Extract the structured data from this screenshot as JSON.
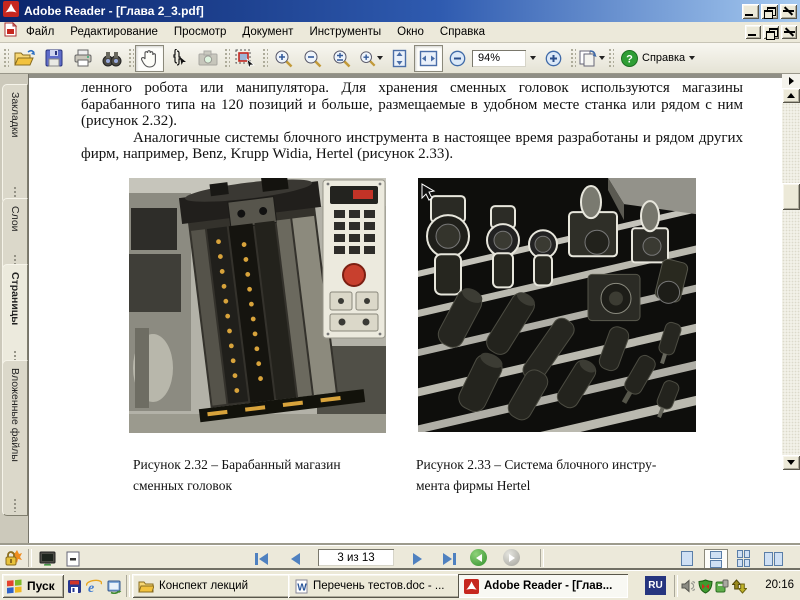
{
  "titlebar": {
    "title": "Adobe Reader - [Глава 2_3.pdf]"
  },
  "menubar": {
    "items": [
      "Файл",
      "Редактирование",
      "Просмотр",
      "Документ",
      "Инструменты",
      "Окно",
      "Справка"
    ]
  },
  "toolbar": {
    "zoom_value": "94%",
    "help_label": "Справка",
    "icons": [
      "open-icon",
      "save-icon",
      "print-icon",
      "search-binoculars-icon",
      "hand-tool-icon",
      "select-text-icon",
      "snapshot-icon",
      "select-image-icon",
      "zoom-in-tool-icon",
      "zoom-out-tool-icon",
      "zoom-dynamic-icon",
      "zoom-tool-menu-icon",
      "fit-height-icon",
      "fit-width-icon",
      "zoom-out-icon",
      "zoom-in-icon",
      "page-view-menu-icon",
      "help-icon"
    ],
    "pressed_tools": [
      "hand-tool",
      "fit-width"
    ]
  },
  "sidebar": {
    "tabs": [
      "Закладки",
      "Слои",
      "Страницы",
      "Вложенные файлы"
    ],
    "active_tab": "Страницы"
  },
  "document": {
    "paragraph1": "ленного робота или манипулятора. Для хранения сменных головок используются магазины барабанного типа на 120 позиций и больше, размещаемые в удобном месте станка или рядом с ним (рисунок 2.32).",
    "paragraph2": "Аналогичные системы блочного инструмента в настоящее время разработаны и рядом других фирм, например, Benz, Krupp Widia, Hertel (рисунок 2.33).",
    "figures": [
      {
        "caption_line1": "Рисунок 2.32 – Барабанный магазин",
        "caption_line2": "сменных головок"
      },
      {
        "caption_line1": "Рисунок 2.33 – Система блочного инстру-",
        "caption_line2": "мента фирмы Hertel"
      }
    ]
  },
  "statusbar": {
    "page_indicator": "3 из 13",
    "icons": [
      "lock-icon",
      "screen-mode-icon",
      "page-size-icon",
      "first-page-icon",
      "prev-page-icon",
      "next-page-icon",
      "last-page-icon",
      "prev-view-icon",
      "next-view-icon",
      "single-page-icon",
      "continuous-icon",
      "continuous-facing-icon",
      "facing-icon"
    ]
  },
  "taskbar": {
    "start_label": "Пуск",
    "quick_launch": [
      "app-disk-icon",
      "internet-explorer-icon",
      "show-desktop-icon"
    ],
    "windows": [
      "Конспект лекций",
      "Перечень тестов.doc - ...",
      "Adobe Reader - [Глав..."
    ],
    "language_indicator": "RU",
    "tray_icons": [
      "volume-icon",
      "antivirus-shield-icon",
      "agent-icon",
      "network-activity-icon"
    ],
    "clock": "20:16"
  },
  "colors": {
    "titlebar_start": "#0a246a",
    "titlebar_end": "#a6caf0",
    "chrome": "#ece9d8",
    "nav_blue": "#4f81c0",
    "help_green": "#2f8f2a",
    "ru_badge": "#26357f"
  }
}
